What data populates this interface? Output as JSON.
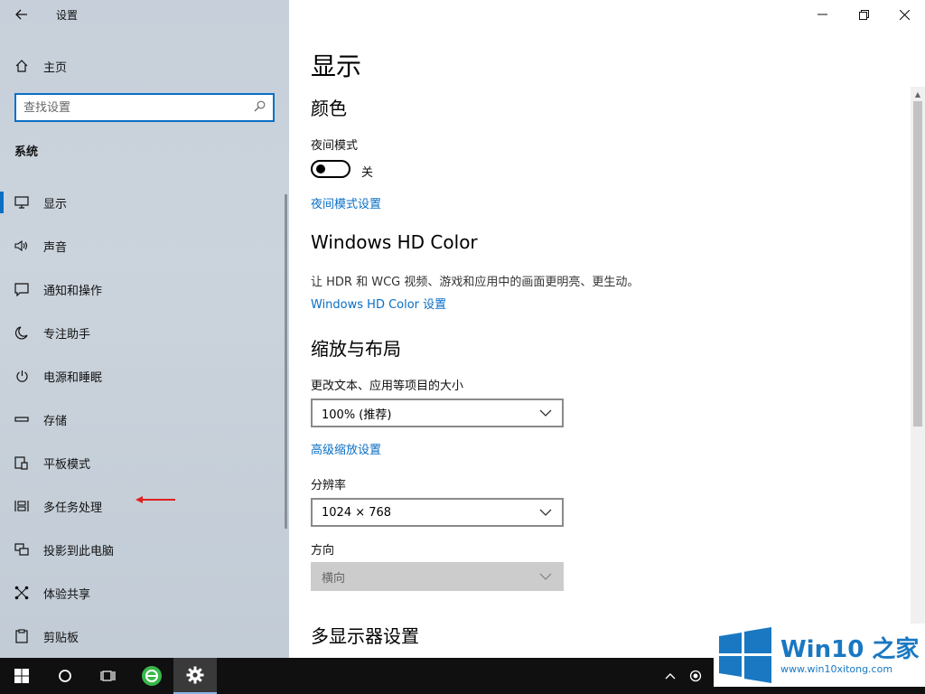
{
  "window": {
    "title": "设置",
    "back_icon": "back-arrow-icon",
    "minimize_glyph": "—",
    "restore_glyph": "❐",
    "close_glyph": "✕"
  },
  "sidebar": {
    "home_label": "主页",
    "search_placeholder": "查找设置",
    "section_title": "系统",
    "items": [
      {
        "label": "显示",
        "icon": "monitor-icon",
        "active": true
      },
      {
        "label": "声音",
        "icon": "speaker-icon"
      },
      {
        "label": "通知和操作",
        "icon": "notification-icon"
      },
      {
        "label": "专注助手",
        "icon": "moon-icon"
      },
      {
        "label": "电源和睡眠",
        "icon": "power-icon"
      },
      {
        "label": "存储",
        "icon": "storage-icon"
      },
      {
        "label": "平板模式",
        "icon": "tablet-icon"
      },
      {
        "label": "多任务处理",
        "icon": "multitask-icon"
      },
      {
        "label": "投影到此电脑",
        "icon": "project-icon"
      },
      {
        "label": "体验共享",
        "icon": "share-icon"
      },
      {
        "label": "剪贴板",
        "icon": "clipboard-icon"
      }
    ]
  },
  "main": {
    "page_title": "显示",
    "color": {
      "heading": "颜色",
      "night_light_label": "夜间模式",
      "night_light_state": "关",
      "night_light_on": false,
      "night_light_settings_link": "夜间模式设置"
    },
    "hdr": {
      "heading": "Windows HD Color",
      "description": "让 HDR 和 WCG 视频、游戏和应用中的画面更明亮、更生动。",
      "settings_link": "Windows HD Color 设置"
    },
    "scale": {
      "heading": "缩放与布局",
      "size_label": "更改文本、应用等项目的大小",
      "size_value": "100% (推荐)",
      "advanced_link": "高级缩放设置",
      "resolution_label": "分辨率",
      "resolution_value": "1024 × 768",
      "orientation_label": "方向",
      "orientation_value": "横向"
    },
    "multi_display": {
      "heading": "多显示器设置"
    }
  },
  "watermark": {
    "title": "Win10 之家",
    "url": "www.win10xitong.com"
  },
  "colors": {
    "accent": "#0a6fc4",
    "taskbar": "#101010"
  }
}
